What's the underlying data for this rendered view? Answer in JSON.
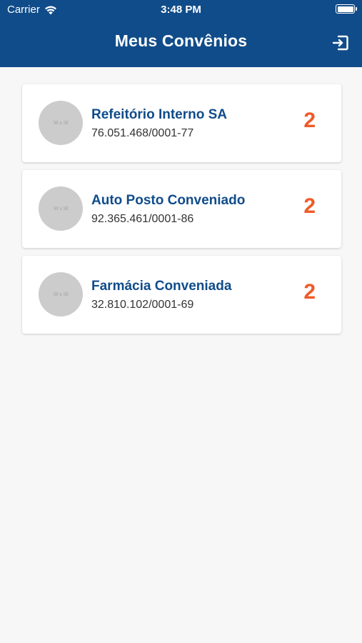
{
  "status_bar": {
    "carrier": "Carrier",
    "time": "3:48 PM"
  },
  "header": {
    "title": "Meus Convênios"
  },
  "colors": {
    "header_bg": "#104c8a",
    "accent": "#f05a28",
    "name_text": "#104c8a"
  },
  "convenios": [
    {
      "name": "Refeitório Interno SA",
      "cnpj": "76.051.468/0001-77",
      "count": "2",
      "avatar_placeholder": "50 x 50"
    },
    {
      "name": "Auto Posto Conveniado",
      "cnpj": "92.365.461/0001-86",
      "count": "2",
      "avatar_placeholder": "50 x 50"
    },
    {
      "name": "Farmácia Conveniada",
      "cnpj": "32.810.102/0001-69",
      "count": "2",
      "avatar_placeholder": "50 x 50"
    }
  ]
}
